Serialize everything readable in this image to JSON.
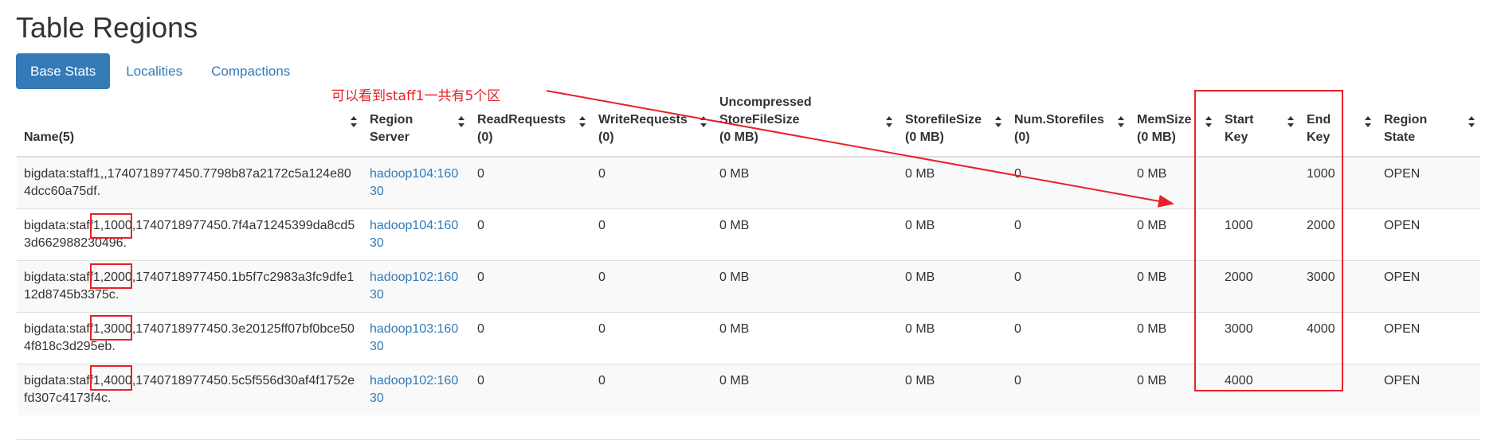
{
  "page_title": "Table Regions",
  "tabs": [
    {
      "label": "Base Stats",
      "active": true
    },
    {
      "label": "Localities",
      "active": false
    },
    {
      "label": "Compactions",
      "active": false
    }
  ],
  "annotation": {
    "text": "可以看到staff1一共有5个区",
    "color": "#e8202a"
  },
  "table": {
    "headers": [
      {
        "key": "name",
        "line1": "Name(5)",
        "line2": ""
      },
      {
        "key": "server",
        "line1": "Region",
        "line2": "Server"
      },
      {
        "key": "read",
        "line1": "ReadRequests",
        "line2": "(0)"
      },
      {
        "key": "write",
        "line1": "WriteRequests",
        "line2": "(0)"
      },
      {
        "key": "uncompressed",
        "line1": "Uncompressed",
        "line2": "StoreFileSize",
        "line3": "(0 MB)"
      },
      {
        "key": "storefilesize",
        "line1": "StorefileSize",
        "line2": "(0 MB)"
      },
      {
        "key": "numstorefiles",
        "line1": "Num.Storefiles",
        "line2": "(0)"
      },
      {
        "key": "memsize",
        "line1": "MemSize",
        "line2": "(0 MB)"
      },
      {
        "key": "startkey",
        "line1": "Start",
        "line2": "Key"
      },
      {
        "key": "endkey",
        "line1": "End",
        "line2": "Key"
      },
      {
        "key": "state",
        "line1": "Region",
        "line2": "State"
      }
    ],
    "rows": [
      {
        "name": "bigdata:staff1,,1740718977450.7798b87a2172c5a124e804dcc60a75df.",
        "server": "hadoop104:16030",
        "read": "0",
        "write": "0",
        "uncompressed": "0 MB",
        "storefilesize": "0 MB",
        "numstorefiles": "0",
        "memsize": "0 MB",
        "startkey": "",
        "endkey": "1000",
        "state": "OPEN"
      },
      {
        "name": "bigdata:staff1,1000,1740718977450.7f4a71245399da8cd53d662988230496.",
        "server": "hadoop104:16030",
        "read": "0",
        "write": "0",
        "uncompressed": "0 MB",
        "storefilesize": "0 MB",
        "numstorefiles": "0",
        "memsize": "0 MB",
        "startkey": "1000",
        "endkey": "2000",
        "state": "OPEN"
      },
      {
        "name": "bigdata:staff1,2000,1740718977450.1b5f7c2983a3fc9dfe112d8745b3375c.",
        "server": "hadoop102:16030",
        "read": "0",
        "write": "0",
        "uncompressed": "0 MB",
        "storefilesize": "0 MB",
        "numstorefiles": "0",
        "memsize": "0 MB",
        "startkey": "2000",
        "endkey": "3000",
        "state": "OPEN"
      },
      {
        "name": "bigdata:staff1,3000,1740718977450.3e20125ff07bf0bce504f818c3d295eb.",
        "server": "hadoop103:16030",
        "read": "0",
        "write": "0",
        "uncompressed": "0 MB",
        "storefilesize": "0 MB",
        "numstorefiles": "0",
        "memsize": "0 MB",
        "startkey": "3000",
        "endkey": "4000",
        "state": "OPEN"
      },
      {
        "name": "bigdata:staff1,4000,1740718977450.5c5f556d30af4f1752efd307c4173f4c.",
        "server": "hadoop102:16030",
        "read": "0",
        "write": "0",
        "uncompressed": "0 MB",
        "storefilesize": "0 MB",
        "numstorefiles": "0",
        "memsize": "0 MB",
        "startkey": "4000",
        "endkey": "",
        "state": "OPEN"
      }
    ]
  },
  "colors": {
    "link": "#337ab7",
    "annotation": "#e8202a",
    "stripe": "#f9f9f9",
    "border": "#dddddd"
  }
}
